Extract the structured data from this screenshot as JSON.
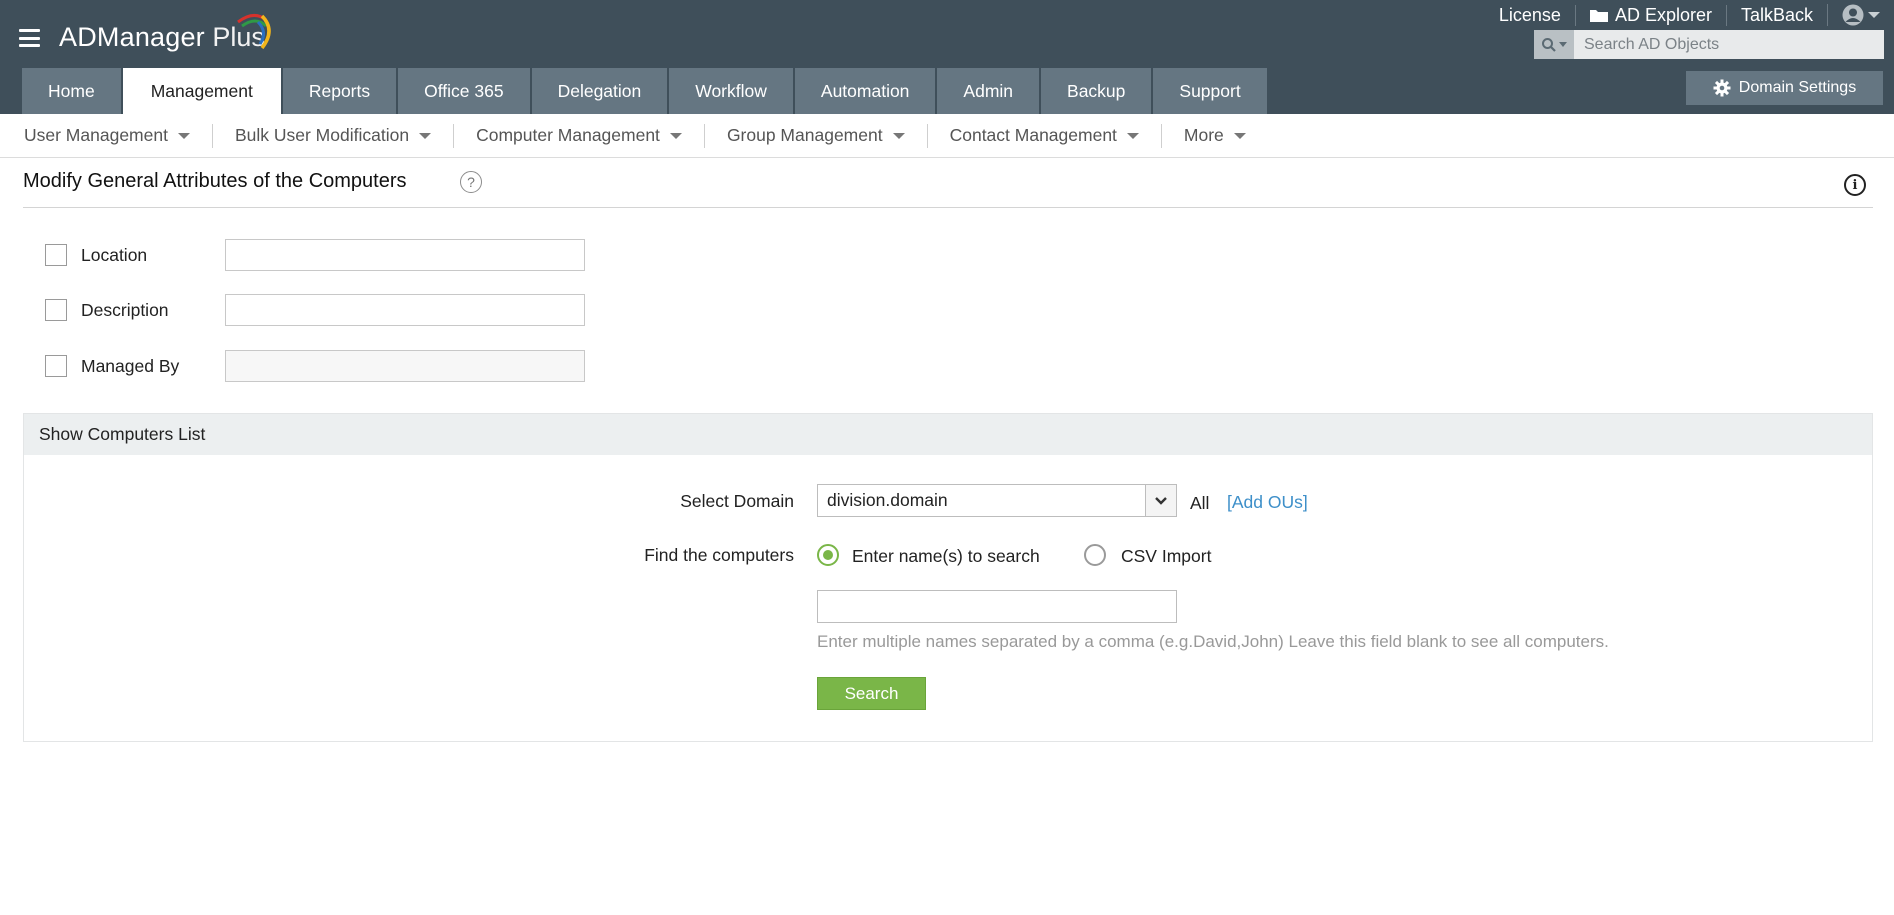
{
  "header": {
    "brand_main": "ADManager",
    "brand_sub": " Plus",
    "links": {
      "license": "License",
      "ad_explorer": "AD Explorer",
      "talkback": "TalkBack"
    },
    "search_placeholder": "Search AD Objects",
    "domain_settings": "Domain Settings",
    "colors": {
      "bar": "#3f4f5a",
      "tab": "#657682",
      "accent_green": "#7ab648",
      "link_blue": "#3d8fc9"
    }
  },
  "tabs": [
    {
      "label": "Home"
    },
    {
      "label": "Management"
    },
    {
      "label": "Reports"
    },
    {
      "label": "Office 365"
    },
    {
      "label": "Delegation"
    },
    {
      "label": "Workflow"
    },
    {
      "label": "Automation"
    },
    {
      "label": "Admin"
    },
    {
      "label": "Backup"
    },
    {
      "label": "Support"
    }
  ],
  "active_tab": "Management",
  "subnav": [
    {
      "label": "User Management"
    },
    {
      "label": "Bulk User Modification"
    },
    {
      "label": "Computer Management"
    },
    {
      "label": "Group Management"
    },
    {
      "label": "Contact Management"
    },
    {
      "label": "More"
    }
  ],
  "page": {
    "title": "Modify General Attributes of the Computers",
    "help_glyph": "?",
    "info_glyph": "i"
  },
  "attributes": [
    {
      "label": "Location",
      "value": ""
    },
    {
      "label": "Description",
      "value": ""
    },
    {
      "label": "Managed By",
      "value": ""
    }
  ],
  "panel": {
    "header": "Show Computers List",
    "select_domain_label": "Select Domain",
    "domain_value": "division.domain",
    "all_label": "All",
    "add_ous": "[Add OUs]",
    "find_label": "Find the computers",
    "radio_names": "Enter name(s) to search",
    "radio_csv": "CSV Import",
    "names_value": "",
    "hint": "Enter multiple names separated by a comma (e.g.David,John) Leave this field blank to see all computers.",
    "search_button": "Search"
  }
}
